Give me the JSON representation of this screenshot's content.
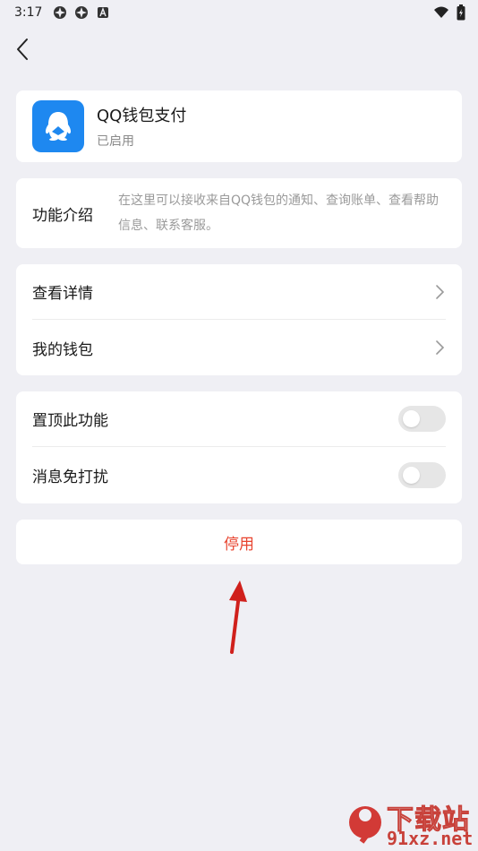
{
  "status_bar": {
    "time": "3:17",
    "icons": [
      "app-notification-icon",
      "app-notification-icon",
      "a-badge-icon",
      "wifi-icon",
      "battery-icon"
    ]
  },
  "nav": {
    "back_icon": "chevron-left-icon"
  },
  "app": {
    "name": "QQ钱包支付",
    "status": "已启用",
    "icon": "qq-wallet-icon",
    "accent": "#1e88f0"
  },
  "intro": {
    "label": "功能介绍",
    "text": "在这里可以接收来自QQ钱包的通知、查询账单、查看帮助信息、联系客服。"
  },
  "links": [
    {
      "label": "查看详情"
    },
    {
      "label": "我的钱包"
    }
  ],
  "toggles": [
    {
      "label": "置顶此功能",
      "on": false
    },
    {
      "label": "消息免打扰",
      "on": false
    }
  ],
  "disable_button": {
    "label": "停用",
    "color": "#e8442f"
  },
  "watermark": {
    "cn": "下载站",
    "en": "91xz.net",
    "logo": "91"
  }
}
